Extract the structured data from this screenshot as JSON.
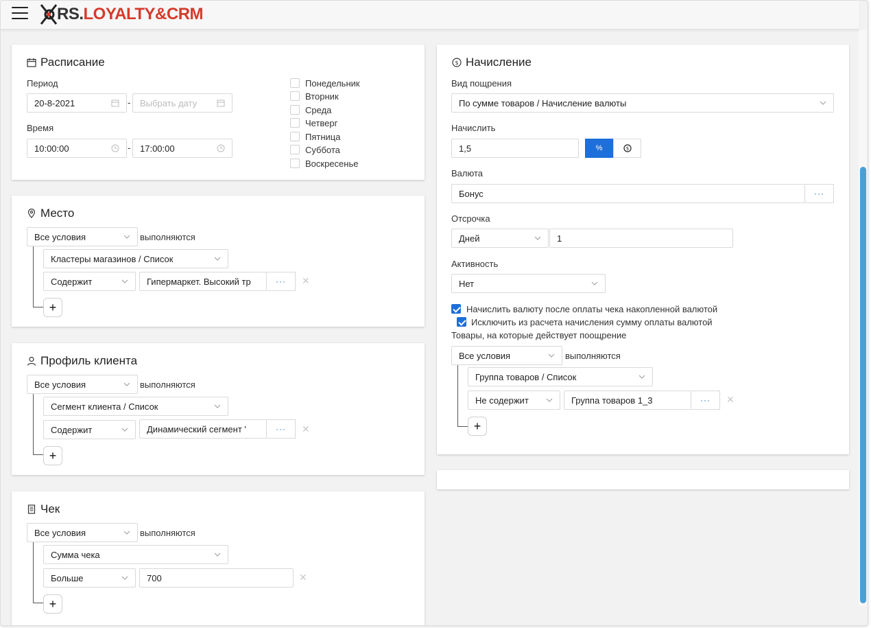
{
  "app": {
    "logo_rs": "RS.",
    "logo_brand": "LOYALTY&CRM"
  },
  "schedule": {
    "title": "Расписание",
    "period_label": "Период",
    "date_from": "20-8-2021",
    "date_to_placeholder": "Выбрать дату",
    "time_label": "Время",
    "time_from": "10:00:00",
    "time_to": "17:00:00",
    "separator": "-",
    "days": [
      "Понедельник",
      "Вторник",
      "Среда",
      "Четверг",
      "Пятница",
      "Суббота",
      "Воскресенье"
    ]
  },
  "place": {
    "title": "Место",
    "conditions_select": "Все условия",
    "conditions_suffix": "выполняются",
    "attribute": "Кластеры магазинов / Список",
    "operator": "Содержит",
    "value": "Гипермаркет. Высокий тр",
    "ellipsis": "···",
    "remove": "✕",
    "add": "+"
  },
  "profile": {
    "title": "Профиль клиента",
    "conditions_select": "Все условия",
    "conditions_suffix": "выполняются",
    "attribute": "Сегмент клиента / Список",
    "operator": "Содержит",
    "value": "Динамический сегмент '",
    "ellipsis": "···",
    "remove": "✕",
    "add": "+"
  },
  "check": {
    "title": "Чек",
    "conditions_select": "Все условия",
    "conditions_suffix": "выполняются",
    "attribute": "Сумма чека",
    "operator": "Больше",
    "value": "700",
    "remove": "✕",
    "add": "+"
  },
  "accrual": {
    "title": "Начисление",
    "reward_type_label": "Вид пощрения",
    "reward_type": "По сумме товаров / Начисление валюты",
    "accrue_label": "Начислить",
    "accrue_value": "1,5",
    "toggle_percent": "%",
    "toggle_currency": "$",
    "currency_label": "Валюта",
    "currency_value": "Бонус",
    "ellipsis": "···",
    "delay_label": "Отсрочка",
    "delay_unit": "Дней",
    "delay_value": "1",
    "activity_label": "Активность",
    "activity_value": "Нет",
    "checkbox1": "Начислить валюту после оплаты чека накопленной валютой",
    "checkbox2": "Исключить из расчета начисления сумму оплаты валютой",
    "goods_label": "Товары, на которые действует поощрение",
    "conditions_select": "Все условия",
    "conditions_suffix": "выполняются",
    "attribute": "Группа товаров / Список",
    "operator": "Не содержит",
    "value": "Группа товаров 1_3",
    "remove": "✕",
    "add": "+"
  },
  "colors": {
    "accent": "#1e6fd9",
    "brand_red": "#d63a2c",
    "scrollbar": "#4aa0d5"
  }
}
